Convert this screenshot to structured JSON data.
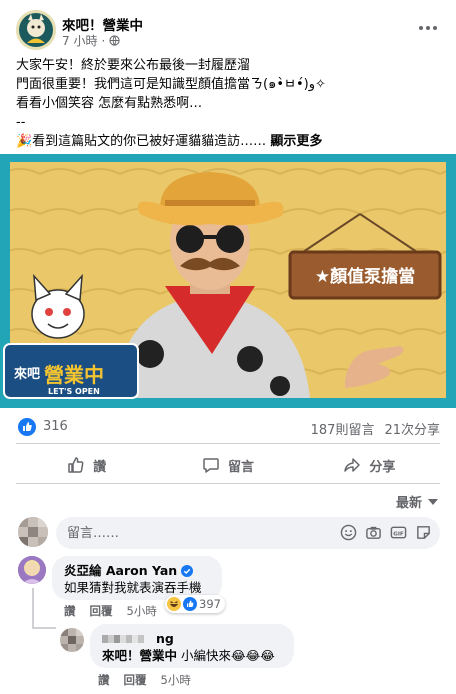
{
  "post": {
    "page_name": "來吧！營業中",
    "time": "7 小時",
    "lines": [
      "大家午安！終於要來公布最後一封履歷溜",
      "門面很重要！我們這可是知識型顏值擔當ㄋ(๑•̀ㅂ•́)و✧",
      "看看小個笑容 怎麼有點熟悉啊…",
      "--",
      "🎉看到這篇貼文的你已被好運貓貓造訪……"
    ],
    "see_more": "顯示更多",
    "banner": {
      "show_logo_top": "來吧",
      "show_logo_main": "營業中",
      "show_logo_sub": "LET'S OPEN",
      "sign_text": "★顏值泵擔當"
    }
  },
  "stats": {
    "likes": "316",
    "comments": "187則留言",
    "shares": "21次分享"
  },
  "actions": {
    "like": "讚",
    "comment": "留言",
    "share": "分享"
  },
  "sort_label": "最新",
  "composer": {
    "placeholder": "留言……"
  },
  "comments": [
    {
      "name": "炎亞綸 Aaron Yan",
      "text": "如果猜對我就表演吞手機",
      "like": "讚",
      "reply": "回覆",
      "time": "5小時",
      "reactions": "397"
    },
    {
      "name": "n",
      "name_suffix": "ng",
      "mention": "來吧！營業中",
      "text": " 小編快來😂😂😂",
      "like": "讚",
      "reply": "回覆",
      "time": "5小時"
    }
  ],
  "colors": {
    "brand_blue": "#1877f2",
    "banner_teal": "#22a5b7",
    "muted": "#65676b"
  }
}
